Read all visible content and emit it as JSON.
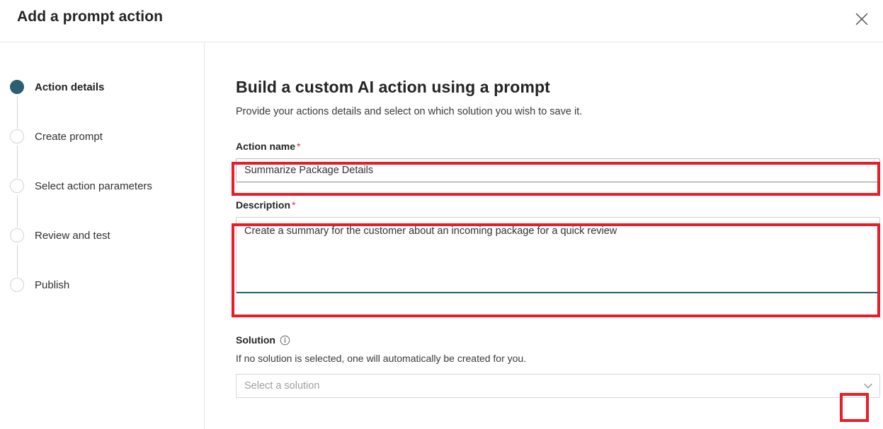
{
  "dialog": {
    "title": "Add a prompt action",
    "close_icon": "close-icon"
  },
  "wizard": {
    "steps": [
      {
        "label": "Action details",
        "state": "active"
      },
      {
        "label": "Create prompt",
        "state": "inactive"
      },
      {
        "label": "Select action parameters",
        "state": "inactive"
      },
      {
        "label": "Review and test",
        "state": "inactive"
      },
      {
        "label": "Publish",
        "state": "inactive"
      }
    ]
  },
  "main": {
    "heading": "Build a custom AI action using a prompt",
    "subheading": "Provide your actions details and select on which solution you wish to save it.",
    "action_name": {
      "label": "Action name",
      "required_mark": "*",
      "value": "Summarize Package Details",
      "placeholder": ""
    },
    "description": {
      "label": "Description",
      "required_mark": "*",
      "value": "Create a summary for the customer about an incoming package for a quick review",
      "placeholder": ""
    },
    "solution": {
      "label": "Solution",
      "info_icon": "info-icon",
      "hint": "If no solution is selected, one will automatically be created for you.",
      "dropdown_placeholder": "Select a solution",
      "dropdown_value": "",
      "chevron_icon": "chevron-down-icon"
    }
  },
  "annotations": {
    "accent_color": "#e81d28",
    "active_step_color": "#2b5f73",
    "required_color": "#d13438",
    "focus_underline_color": "#2b5f73"
  }
}
